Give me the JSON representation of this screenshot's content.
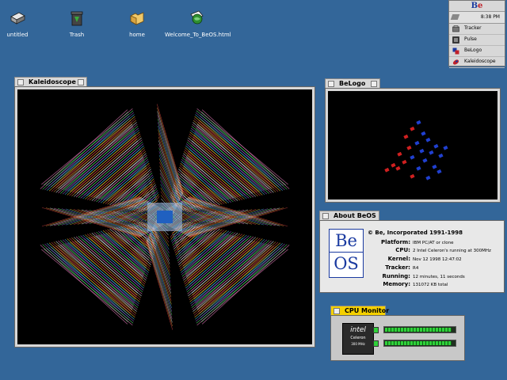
{
  "desktop": {
    "icons": [
      {
        "label": "untitled",
        "icon": "hard-disk-icon"
      },
      {
        "label": "Trash",
        "icon": "trash-icon"
      },
      {
        "label": "home",
        "icon": "folder-icon"
      },
      {
        "label": "Welcome_To_BeOS.html",
        "icon": "html-document-icon"
      }
    ],
    "background_color": "#336699"
  },
  "deskbar": {
    "logo": "Be",
    "clock": "8:38 PM",
    "apps": [
      {
        "label": "Tracker",
        "icon": "tracker-icon"
      },
      {
        "label": "Pulse",
        "icon": "pulse-icon"
      },
      {
        "label": "BeLogo",
        "icon": "belogo-icon"
      },
      {
        "label": "Kaleidoscope",
        "icon": "kaleidoscope-icon"
      }
    ]
  },
  "windows": {
    "kaleidoscope": {
      "title": "Kaleidoscope"
    },
    "belogo": {
      "title": "BeLogo"
    },
    "about": {
      "title": "About BeOS",
      "logo_top": "Be",
      "logo_bottom": "OS",
      "copyright": "© Be, Incorporated 1991-1998",
      "rows": [
        {
          "key": "Platform:",
          "value": "IBM PC/AT or clone"
        },
        {
          "key": "CPU:",
          "value": "2 Intel Celeron's running at 300MHz"
        },
        {
          "key": "Kernel:",
          "value": "Nov 12 1998 12:47:02"
        },
        {
          "key": "Tracker:",
          "value": "R4"
        },
        {
          "key": "Running:",
          "value": "12 minutes, 11 seconds"
        },
        {
          "key": "Memory:",
          "value": "131072 KB total"
        }
      ]
    },
    "cpu_monitor": {
      "title": "CPU Monitor",
      "chip_brand": "intel",
      "chip_model": "Celeron",
      "chip_speed": "300 MHz",
      "cpu_load": [
        0.95,
        0.95
      ]
    }
  },
  "colors": {
    "accent_yellow": "#f4d000",
    "meter_green": "#2fd13a",
    "be_blue": "#1a3aa0",
    "be_red": "#c0202a"
  }
}
